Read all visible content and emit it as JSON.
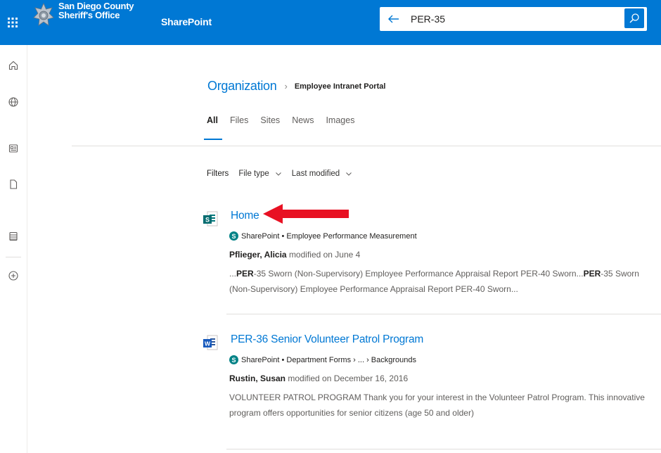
{
  "topbar": {
    "org_line1": "San Diego County",
    "org_line2": "Sheriff's Office",
    "app_name": "SharePoint",
    "search_query": "PER-35",
    "brand_color": "#0078d4"
  },
  "rail": {
    "icons": [
      "home-icon",
      "globe-icon",
      "news-icon",
      "file-icon",
      "list-icon",
      "add-icon"
    ]
  },
  "breadcrumb": {
    "root": "Organization",
    "separator": "›",
    "current": "Employee Intranet Portal"
  },
  "tabs": [
    "All",
    "Files",
    "Sites",
    "News",
    "Images"
  ],
  "filters": {
    "label": "Filters",
    "file_type": "File type",
    "last_modified": "Last modified"
  },
  "results": [
    {
      "icon": "sharepoint-page-icon",
      "title": "Home",
      "path": "SharePoint • Employee Performance Measurement",
      "author": "Pflieger, Alicia",
      "modified_text": "modified on June 4",
      "snippet_parts": [
        {
          "t": "...",
          "b": false
        },
        {
          "t": "PER",
          "b": true
        },
        {
          "t": "-35 Sworn (Non-Supervisory) Employee Performance Appraisal Report PER-40 Sworn...",
          "b": false
        },
        {
          "t": "PER",
          "b": true
        },
        {
          "t": "-35 Sworn (Non-Supervisory) Employee Performance Appraisal Report PER-40 Sworn...",
          "b": false
        }
      ]
    },
    {
      "icon": "word-document-icon",
      "title": "PER-36 Senior Volunteer Patrol Program",
      "path": "SharePoint • Department Forms › ... › Backgrounds",
      "author": "Rustin, Susan",
      "modified_text": "modified on December 16, 2016",
      "snippet_parts": [
        {
          "t": "VOLUNTEER PATROL PROGRAM Thank you for your interest in the Volunteer Patrol Program. This innovative program offers opportunities for senior citizens (age 50 and older)",
          "b": false
        }
      ]
    }
  ],
  "annotation_arrow_color": "#e81123"
}
